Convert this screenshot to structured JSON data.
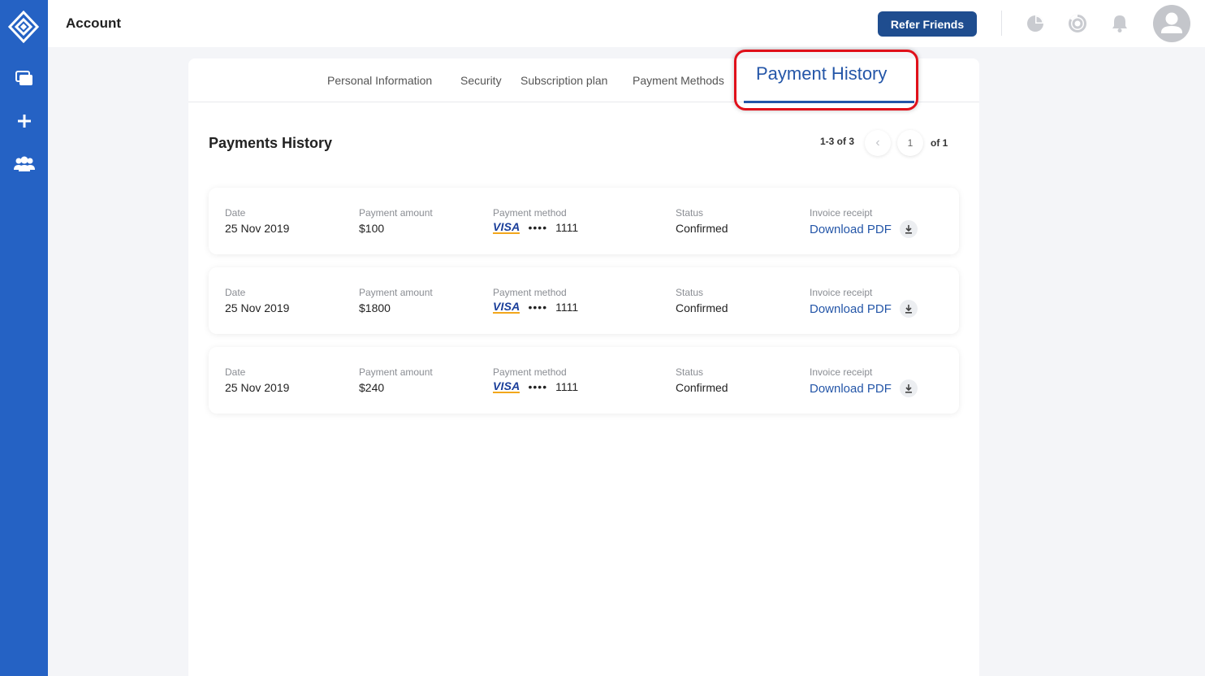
{
  "header": {
    "title": "Account",
    "refer_label": "Refer Friends"
  },
  "tabs": [
    {
      "label": "Personal Information"
    },
    {
      "label": "Security"
    },
    {
      "label": "Subscription plan"
    },
    {
      "label": "Payment Methods"
    },
    {
      "label": "Payment History",
      "active": true
    }
  ],
  "section": {
    "title": "Payments History"
  },
  "pager": {
    "range": "1-3 of 3",
    "prev": "‹",
    "page": "1",
    "total": "of 1"
  },
  "labels": {
    "date": "Date",
    "amount": "Payment amount",
    "method": "Payment method",
    "status": "Status",
    "invoice": "Invoice receipt"
  },
  "payments": [
    {
      "date": "25 Nov 2019",
      "amount": "$100",
      "card_brand": "VISA",
      "card_mask": "••••",
      "card_last4": "1111",
      "status": "Confirmed",
      "download": "Download PDF"
    },
    {
      "date": "25 Nov 2019",
      "amount": "$1800",
      "card_brand": "VISA",
      "card_mask": "••••",
      "card_last4": "1111",
      "status": "Confirmed",
      "download": "Download PDF"
    },
    {
      "date": "25 Nov 2019",
      "amount": "$240",
      "card_brand": "VISA",
      "card_mask": "••••",
      "card_last4": "1111",
      "status": "Confirmed",
      "download": "Download PDF"
    }
  ],
  "icons": {
    "logo": "diamond-logo-icon",
    "sidebar": [
      "windows-icon",
      "plus-icon",
      "users-icon"
    ],
    "header": [
      "pie-chart-icon",
      "progress-ring-icon",
      "bell-icon",
      "user-avatar-icon"
    ],
    "download": "download-icon"
  },
  "colors": {
    "sidebar": "#2562c4",
    "primary": "#2456a8",
    "refer_button": "#1f4d8f",
    "highlight": "#e0101a",
    "visa_blue": "#1a3e9a",
    "visa_gold": "#f2a71b"
  }
}
